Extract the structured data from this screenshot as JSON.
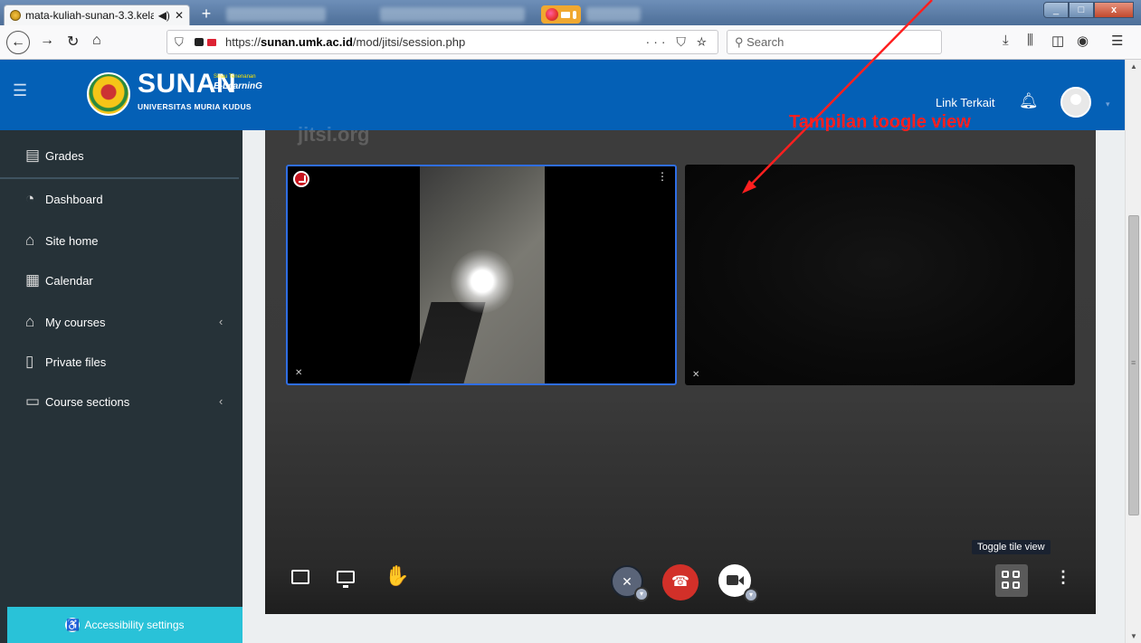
{
  "browser": {
    "tab_title": "mata-kuliah-sunan-3.3.kela",
    "tab_sound": "◀)",
    "tab_close": "✕",
    "new_tab": "+",
    "url_host": "sunan.umk.ac.id",
    "url_prefix": "https://",
    "url_path": "/mod/jitsi/session.php",
    "url_actions": "··· ⛉ ☆",
    "search_placeholder": "Search",
    "window_controls": {
      "min": "_",
      "max": "□",
      "close": "x"
    }
  },
  "header": {
    "brand": "SUNAN",
    "brand_tagline_small": "Sinau Tenenanan",
    "brand_tagline": "E-LearninG",
    "university": "UNIVERSITAS MURIA KUDUS",
    "link_terkait": "Link Terkait"
  },
  "sidebar": {
    "items": [
      {
        "label": "Grades",
        "icon": "gradebook-icon"
      },
      {
        "label": "Dashboard",
        "icon": "dashboard-icon"
      },
      {
        "label": "Site home",
        "icon": "home-icon"
      },
      {
        "label": "Calendar",
        "icon": "calendar-icon"
      },
      {
        "label": "My courses",
        "icon": "graduation-cap-icon"
      },
      {
        "label": "Private files",
        "icon": "file-icon"
      },
      {
        "label": "Course sections",
        "icon": "folder-icon"
      }
    ],
    "accessibility": "Accessibility settings"
  },
  "jitsi": {
    "watermark": "jitsi.org",
    "tooltip": "Toggle tile view"
  },
  "annotation": {
    "text": "Tampilan toogle view",
    "color": "#ff1f1f"
  },
  "colors": {
    "header_blue": "#0460b6",
    "sidebar": "#263238",
    "accessibility_bar": "#29c2d8",
    "hangup_red": "#d23029",
    "active_tile_border": "#2f6ee4"
  }
}
